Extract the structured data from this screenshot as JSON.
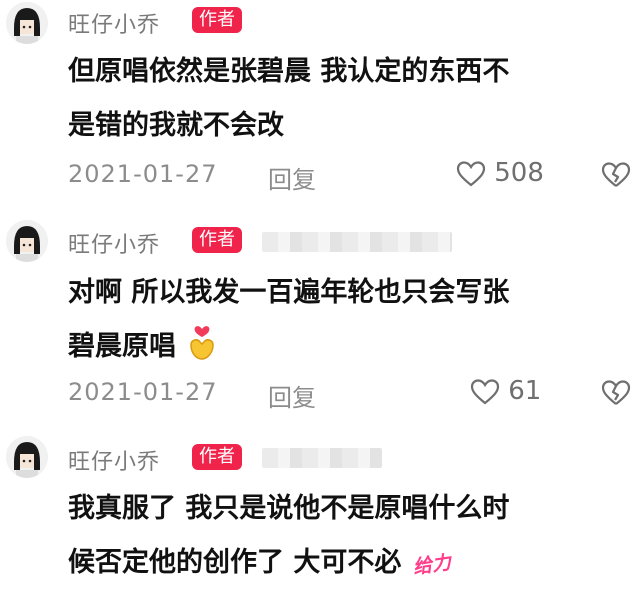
{
  "author_badge": "作者",
  "comments": [
    {
      "user": "旺仔小乔",
      "text_lines": [
        "但原唱依然是张碧晨 我认定的东西不",
        "是错的我就不会改"
      ],
      "date": "2021-01-27",
      "reply_label": "回复",
      "likes": "508"
    },
    {
      "user": "旺仔小乔",
      "text_lines": [
        "对啊 所以我发一百遍年轮也只会写张",
        "碧晨原唱"
      ],
      "date": "2021-01-27",
      "reply_label": "回复",
      "likes": "61"
    },
    {
      "user": "旺仔小乔",
      "text_lines": [
        "我真服了 我只是说他不是原唱什么时",
        "候否定他的创作了 大可不必"
      ],
      "sticker_text": "给力"
    }
  ],
  "icons": {
    "avatar": "avatar-icon",
    "like": "heart-outline-icon",
    "dislike": "broken-heart-icon",
    "emoji": "heart-hands-emoji-icon"
  },
  "colors": {
    "badge": "#f0234b",
    "username": "#7a7a7a",
    "meta": "#8c8c8c",
    "sticker": "#ff3d8b"
  }
}
